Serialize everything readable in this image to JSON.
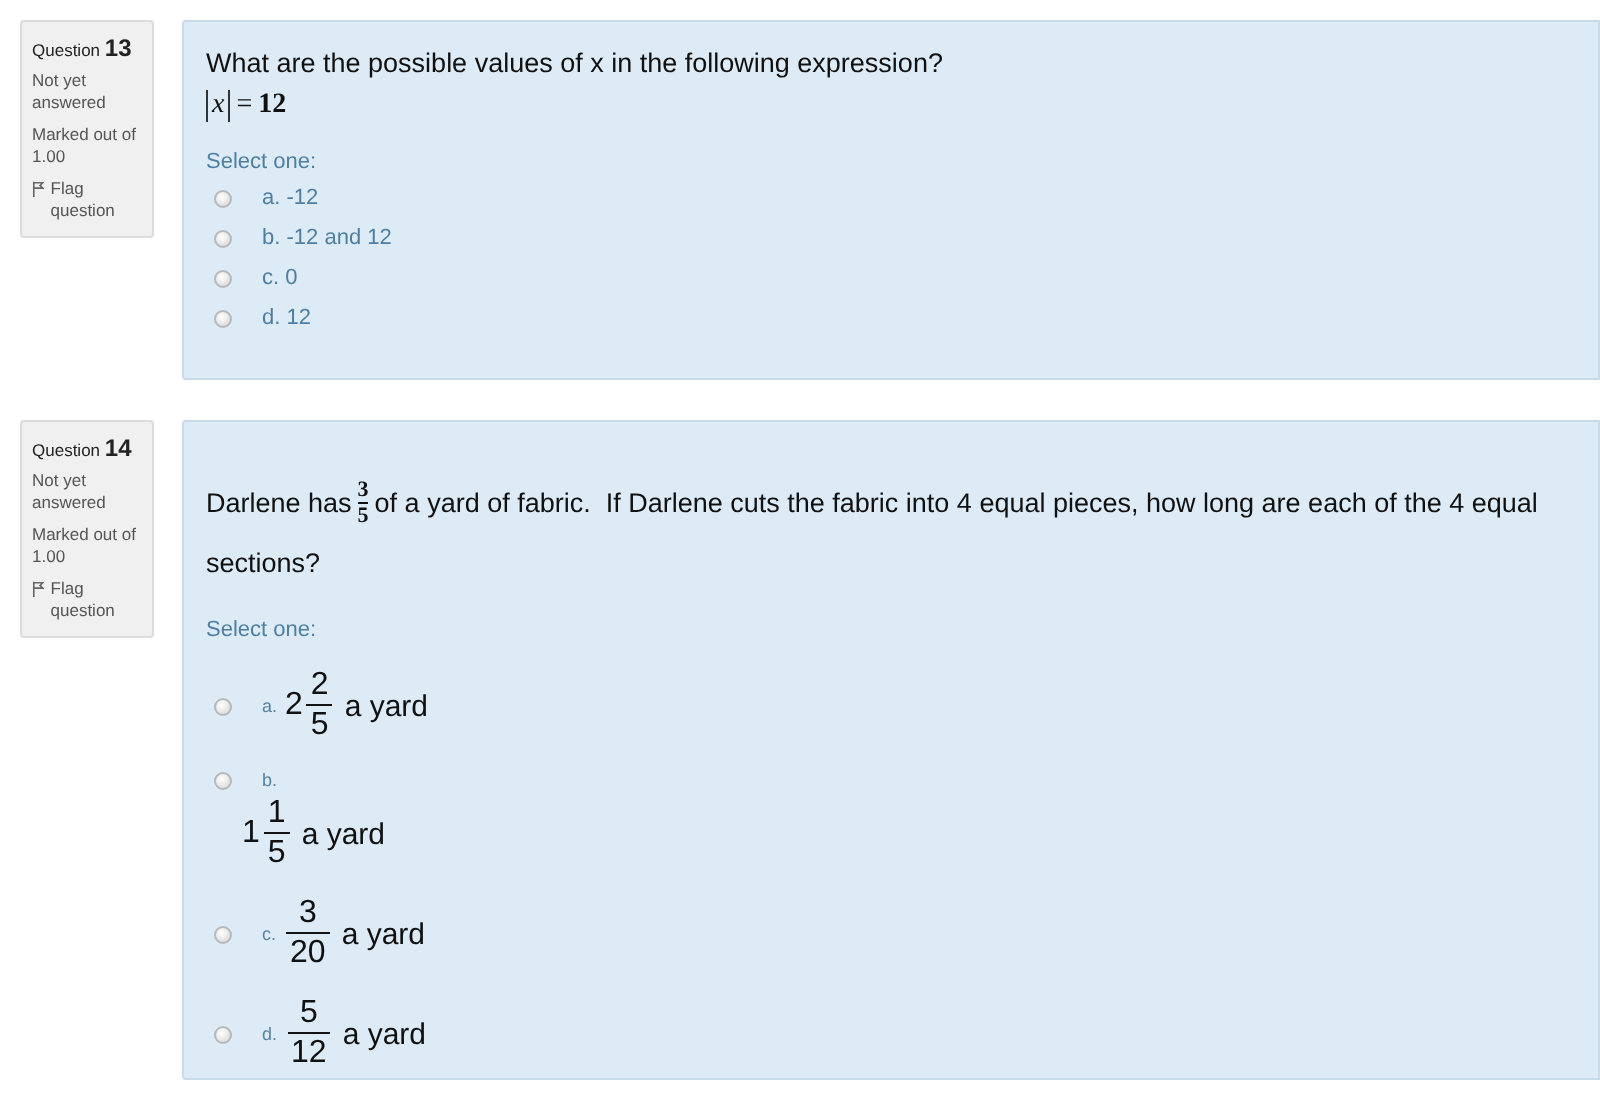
{
  "questions": [
    {
      "label": "Question",
      "number": "13",
      "status": "Not yet answered",
      "marks": "Marked out of 1.00",
      "flag": "Flag question",
      "flagged": false,
      "prompt": {
        "kind": "plain",
        "text": "What are the possible values of x in the following expression?"
      },
      "formula": {
        "variable": "x",
        "operator": "=",
        "value": "12"
      },
      "select_label": "Select one:",
      "options": [
        {
          "kind": "plain",
          "letter": "a.",
          "text": "-12",
          "selected": false
        },
        {
          "kind": "plain",
          "letter": "b.",
          "text": "-12 and 12",
          "selected": false
        },
        {
          "kind": "plain",
          "letter": "c.",
          "text": "0",
          "selected": false
        },
        {
          "kind": "plain",
          "letter": "d.",
          "text": "12",
          "selected": false
        }
      ]
    },
    {
      "label": "Question",
      "number": "14",
      "status": "Not yet answered",
      "marks": "Marked out of 1.00",
      "flag": "Flag question",
      "flagged": false,
      "prompt": {
        "kind": "fraction",
        "before": "Darlene has",
        "numerator": "3",
        "denominator": "5",
        "after": "of a yard of fabric.  If Darlene cuts the fabric into 4 equal pieces, how long are each of the 4 equal sections?"
      },
      "select_label": "Select one:",
      "options": [
        {
          "kind": "fraction",
          "letter": "a.",
          "whole": "2",
          "numerator": "2",
          "denominator": "5",
          "unit": "a yard",
          "wrapped": false,
          "selected": false
        },
        {
          "kind": "fraction",
          "letter": "b.",
          "whole": "1",
          "numerator": "1",
          "denominator": "5",
          "unit": "a yard",
          "wrapped": true,
          "selected": false
        },
        {
          "kind": "fraction",
          "letter": "c.",
          "numerator": "3",
          "denominator": "20",
          "unit": "a yard",
          "wrapped": false,
          "selected": false
        },
        {
          "kind": "fraction",
          "letter": "d.",
          "numerator": "5",
          "denominator": "12",
          "unit": "a yard",
          "wrapped": false,
          "selected": false
        }
      ]
    }
  ]
}
